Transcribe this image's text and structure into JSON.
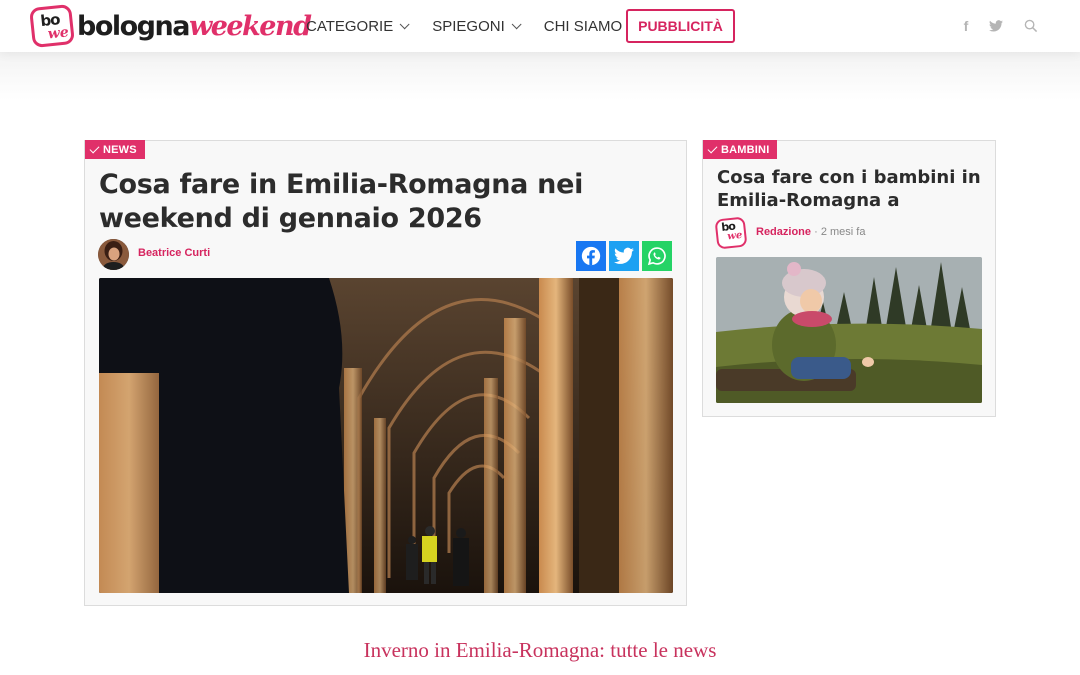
{
  "header": {
    "logo_badge_top": "bo",
    "logo_badge_bottom": "we",
    "logo_text_1": "bologna",
    "logo_text_2": "weekend",
    "nav": [
      {
        "label": "CATEGORIE",
        "has_dropdown": true
      },
      {
        "label": "SPIEGONI",
        "has_dropdown": true
      },
      {
        "label": "CHI SIAMO",
        "has_dropdown": false
      }
    ],
    "cta": "PUBBLICITÀ",
    "social_icons": [
      "facebook-icon",
      "twitter-icon",
      "search-icon"
    ]
  },
  "colors": {
    "accent": "#e0306a",
    "facebook": "#1877f2",
    "twitter": "#1da1f2",
    "whatsapp": "#25d366",
    "footer_link": "#c8325d"
  },
  "main_article": {
    "tag": "NEWS",
    "title": "Cosa fare in Emilia-Romagna nei weekend di gennaio 2026",
    "author": "Beatrice Curti",
    "share": [
      "facebook-icon",
      "twitter-icon",
      "whatsapp-icon"
    ]
  },
  "side_article": {
    "tag": "BAMBINI",
    "title": "Cosa fare con i bambini in Emilia-Romagna a",
    "author": "Redazione",
    "time": "2 mesi fa",
    "avatar_top": "bo",
    "avatar_bottom": "we"
  },
  "footer_link": "Inverno in Emilia-Romagna: tutte le news"
}
